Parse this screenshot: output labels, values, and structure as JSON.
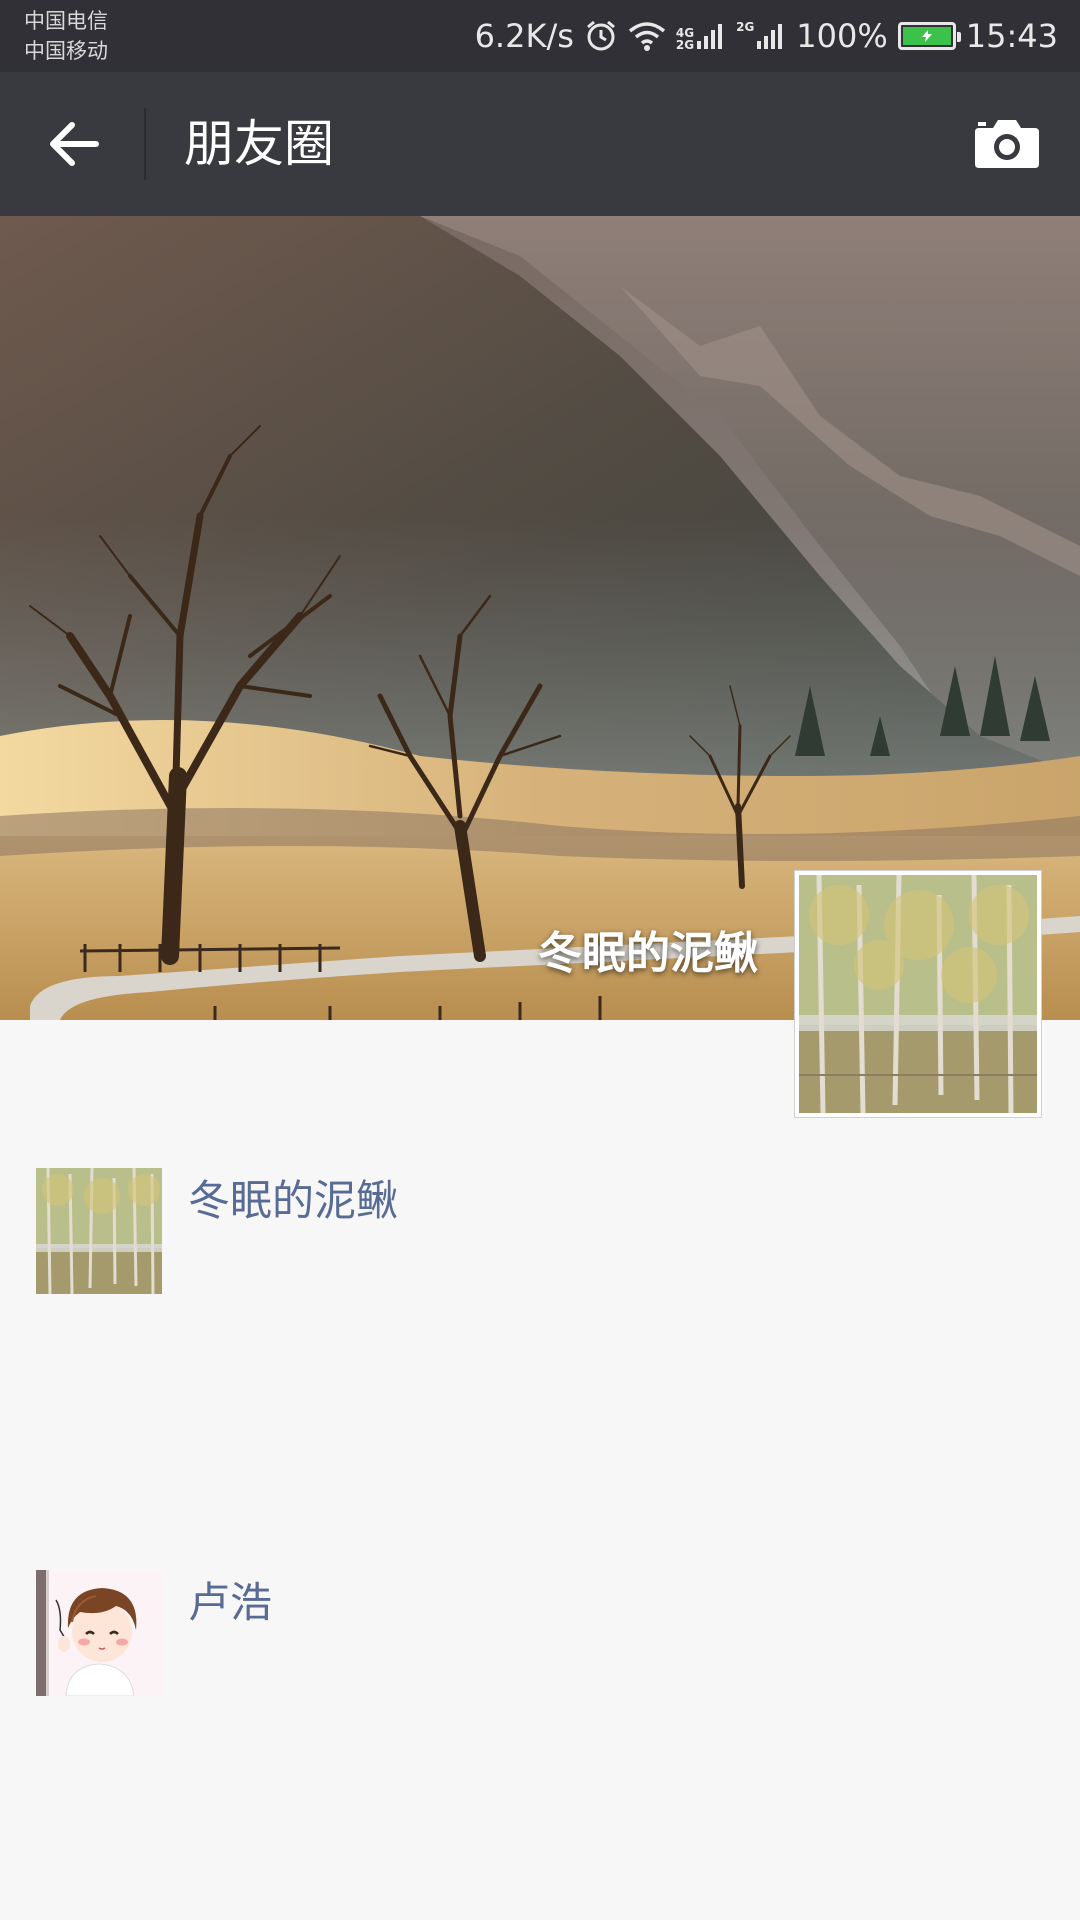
{
  "status_bar": {
    "carrier_1": "中国电信",
    "carrier_2": "中国移动",
    "net_speed": "6.2K/s",
    "network_1": "4G\n2G",
    "network_2": "2G",
    "battery": "100%",
    "time": "15:43",
    "battery_color": "#3cc24a"
  },
  "nav": {
    "title": "朋友圈",
    "back_icon": "arrow-left-icon",
    "camera_icon": "camera-icon"
  },
  "cover": {
    "user_name": "冬眠的泥鳅"
  },
  "feed": [
    {
      "name": "冬眠的泥鳅"
    },
    {
      "name": "卢浩"
    }
  ],
  "colors": {
    "nav_bg": "#393a3f",
    "status_bg": "#303036",
    "name_link": "#576b95",
    "page_bg": "#f7f7f7"
  }
}
